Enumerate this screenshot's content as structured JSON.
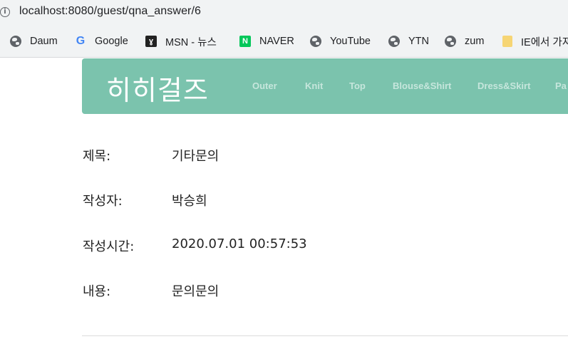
{
  "browser": {
    "url": "localhost:8080/guest/qna_answer/6",
    "bookmarks": [
      {
        "label": "Daum",
        "icon": "globe-icon"
      },
      {
        "label": "Google",
        "icon": "google-icon"
      },
      {
        "label": "MSN - 뉴스",
        "icon": "msn-icon"
      },
      {
        "label": "NAVER",
        "icon": "naver-icon"
      },
      {
        "label": "YouTube",
        "icon": "globe-icon"
      },
      {
        "label": "YTN",
        "icon": "globe-icon"
      },
      {
        "label": "zum",
        "icon": "globe-icon"
      },
      {
        "label": "IE에서 가져",
        "icon": "folder-icon"
      }
    ]
  },
  "site": {
    "logo": "히히걸즈",
    "nav": [
      "Outer",
      "Knit",
      "Top",
      "Blouse&Shirt",
      "Dress&Skirt",
      "Pa"
    ],
    "header_color": "#7bc3ad"
  },
  "qna": {
    "title_label": "제목:",
    "title_value": "기타문의",
    "author_label": "작성자:",
    "author_value": "박승희",
    "time_label": "작성시간:",
    "time_value": "2020.07.01 00:57:53",
    "content_label": "내용:",
    "content_value": "문의문의"
  }
}
